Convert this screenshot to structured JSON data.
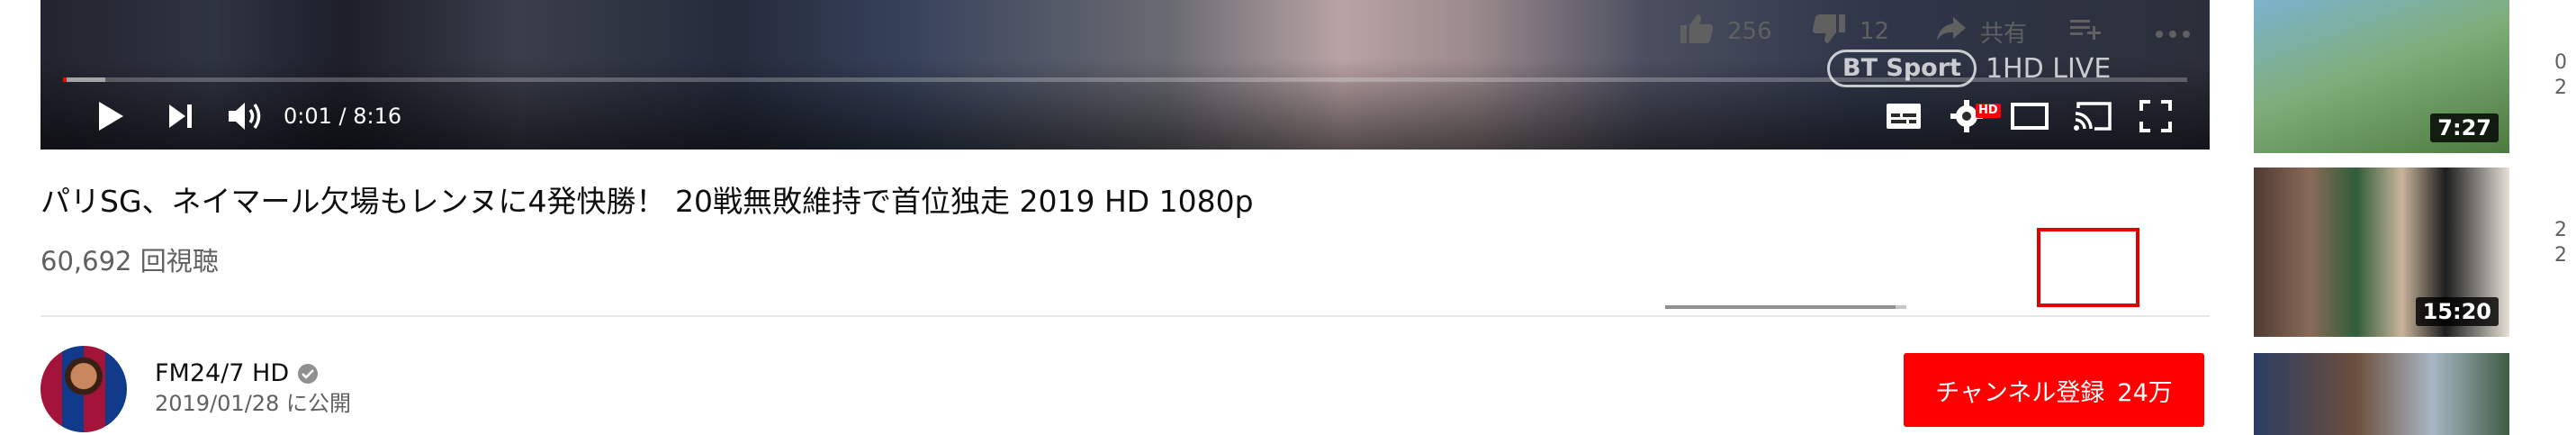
{
  "player": {
    "time_display": "0:01 / 8:16",
    "watermark_brand": "BT Sport",
    "watermark_rest": "1HD LIVE",
    "hd_badge": "HD",
    "progress_played_fraction": 0.0,
    "progress_buffered_fraction": 0.02,
    "icons": [
      "play-icon",
      "next-icon",
      "volume-icon",
      "subtitles-icon",
      "settings-icon",
      "theater-mode-icon",
      "cast-icon",
      "fullscreen-icon"
    ]
  },
  "video": {
    "title": "パリSG、ネイマール欠場もレンヌに4発快勝！ 20戦無敗維持で首位独走 2019 HD 1080p",
    "views": "60,692 回視聴"
  },
  "actions": {
    "like_count": "256",
    "dislike_count": "12",
    "share_label": "共有",
    "like_fraction": 0.955
  },
  "channel": {
    "name": "FM24/7 HD",
    "published": "2019/01/28 に公開",
    "subscribe_label": "チャンネル登録",
    "subscriber_count": "24万"
  },
  "sidebar": {
    "items": [
      {
        "duration": "7:27",
        "meta": "0 2"
      },
      {
        "duration": "15:20",
        "meta": "2 2"
      },
      {
        "duration": "",
        "meta": ""
      }
    ]
  },
  "colors": {
    "accent_red": "#ff0000",
    "text_secondary": "#606060",
    "highlight_box": "#e00000"
  }
}
